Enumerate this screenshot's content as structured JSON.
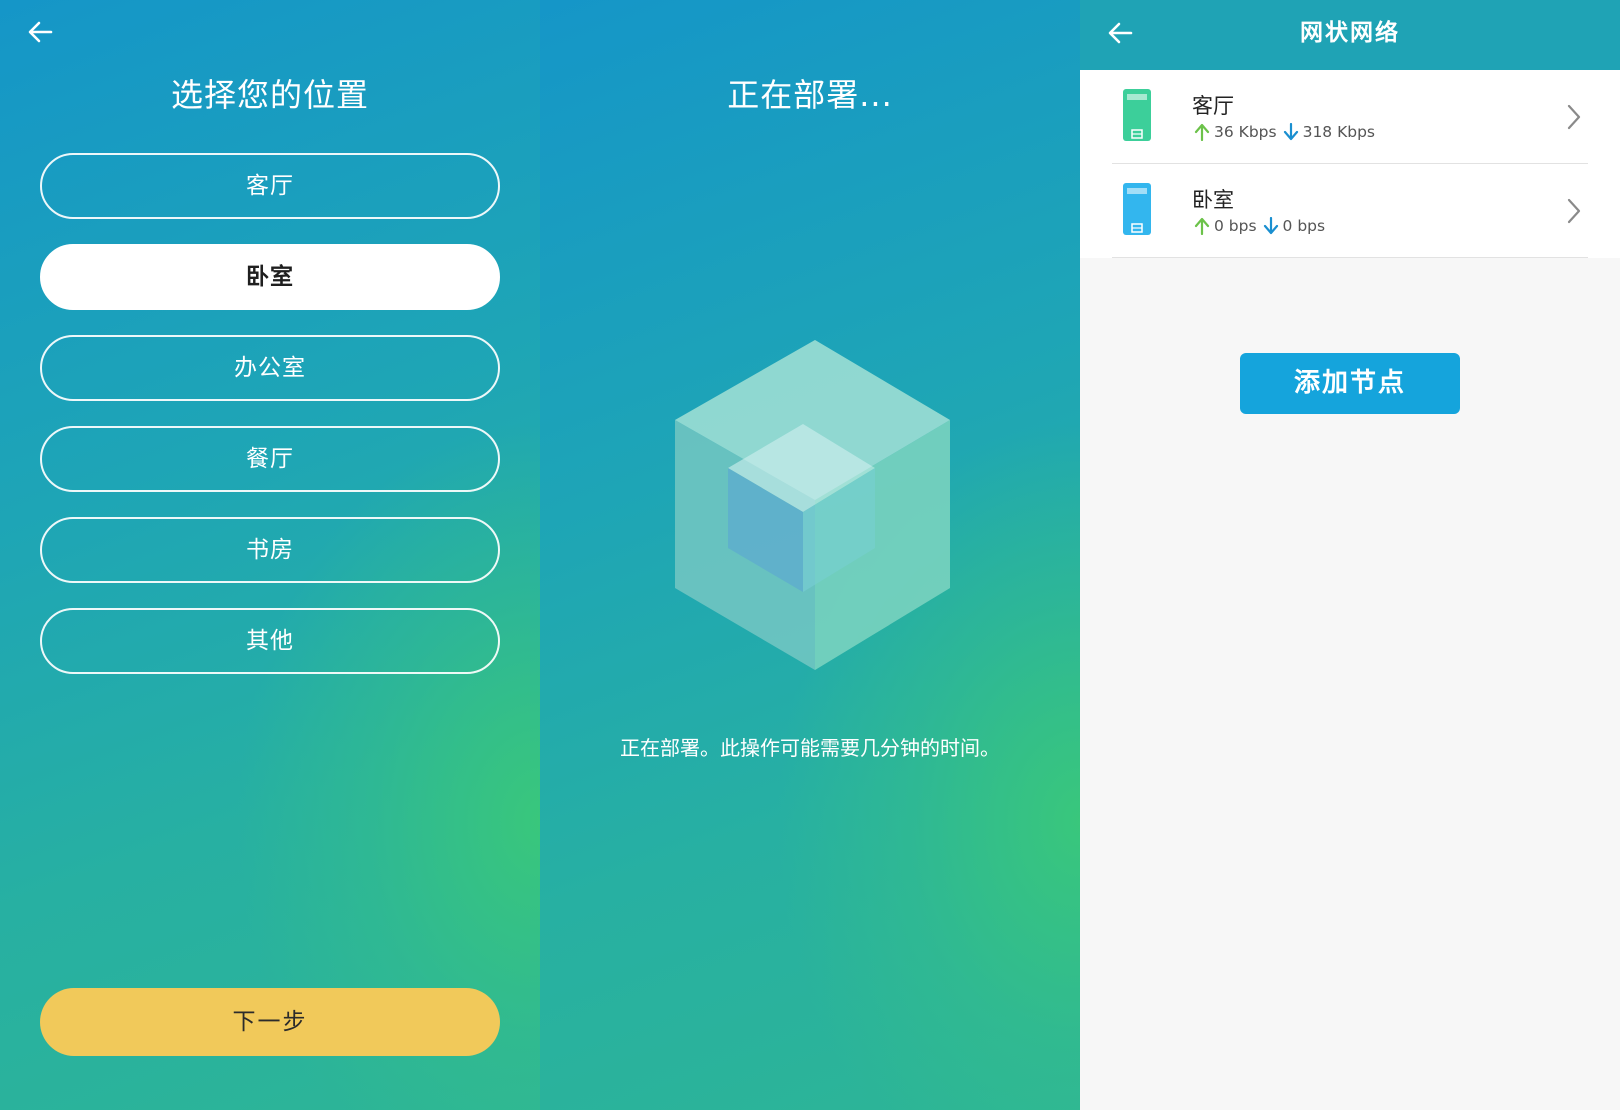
{
  "left": {
    "title": "选择您的位置",
    "locations": [
      {
        "label": "客厅",
        "selected": false
      },
      {
        "label": "卧室",
        "selected": true
      },
      {
        "label": "办公室",
        "selected": false
      },
      {
        "label": "餐厅",
        "selected": false
      },
      {
        "label": "书房",
        "selected": false
      },
      {
        "label": "其他",
        "selected": false
      }
    ],
    "next_label": "下一步"
  },
  "middle": {
    "title": "正在部署...",
    "message": "正在部署。此操作可能需要几分钟的时间。"
  },
  "right": {
    "title": "网状网络",
    "nodes": [
      {
        "name": "客厅",
        "upload": "36 Kbps",
        "download": "318 Kbps",
        "icon": "router-icon",
        "color": "#3ccf9a"
      },
      {
        "name": "卧室",
        "upload": "0 bps",
        "download": "0 bps",
        "icon": "router-icon",
        "color": "#33b6ee"
      }
    ],
    "add_label": "添加节点"
  },
  "colors": {
    "accent_yellow": "#f1c95a",
    "button_blue": "#15a4dc",
    "upload_green": "#6cc24a",
    "download_blue": "#1a8fd0",
    "header_teal": "#1fa3b5"
  }
}
